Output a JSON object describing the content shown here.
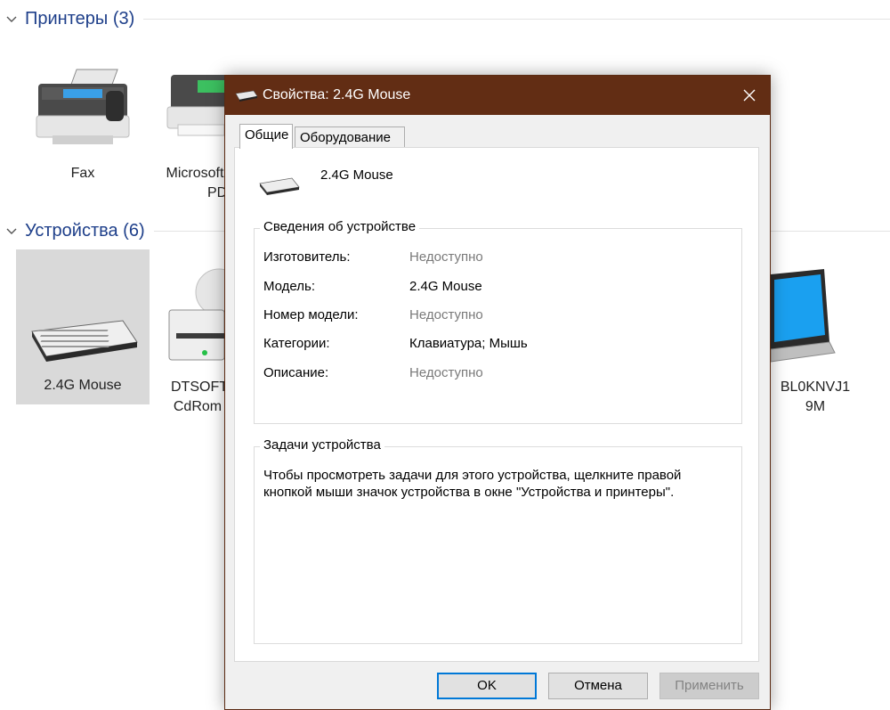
{
  "background": {
    "printers_group": {
      "title": "Принтеры (3)"
    },
    "devices_group": {
      "title": "Устройства (6)"
    },
    "printers": [
      {
        "label": "Fax",
        "icon": "fax-icon"
      },
      {
        "label": "Microsoft Print to PDF",
        "label_line1": "Microsoft",
        "label_line2": "PD",
        "icon": "printer-icon"
      }
    ],
    "devices": [
      {
        "label": "2.4G Mouse",
        "icon": "keyboard-icon",
        "selected": true
      },
      {
        "label_line1": "DTSOFT",
        "label_line2": "CdRom",
        "icon": "cdrom-drive-icon"
      },
      {
        "label_line1": "BL0KNVJ1",
        "label_line2": "9M",
        "icon": "laptop-icon"
      }
    ]
  },
  "dialog": {
    "title": "Свойства: 2.4G Mouse",
    "tabs": [
      {
        "label": "Общие",
        "active": true
      },
      {
        "label": "Оборудование",
        "active": false
      }
    ],
    "device_name": "2.4G Mouse",
    "info_group": {
      "title": "Сведения об устройстве",
      "rows": [
        {
          "label": "Изготовитель:",
          "value": "Недоступно",
          "unavailable": true
        },
        {
          "label": "Модель:",
          "value": "2.4G Mouse",
          "unavailable": false
        },
        {
          "label": "Номер модели:",
          "value": "Недоступно",
          "unavailable": true
        },
        {
          "label": "Категории:",
          "value": "Клавиатура; Мышь",
          "unavailable": false
        },
        {
          "label": "Описание:",
          "value": "Недоступно",
          "unavailable": true
        }
      ]
    },
    "tasks_group": {
      "title": "Задачи устройства",
      "text": "Чтобы просмотреть задачи для этого устройства, щелкните правой кнопкой мыши значок устройства в окне \"Устройства и принтеры\"."
    },
    "buttons": {
      "ok": "OK",
      "cancel": "Отмена",
      "apply": "Применить"
    }
  },
  "colors": {
    "titlebar": "#622d14",
    "group_title": "#1e3f8a",
    "selection": "#d9d9d9",
    "focus_border": "#0078d7"
  }
}
